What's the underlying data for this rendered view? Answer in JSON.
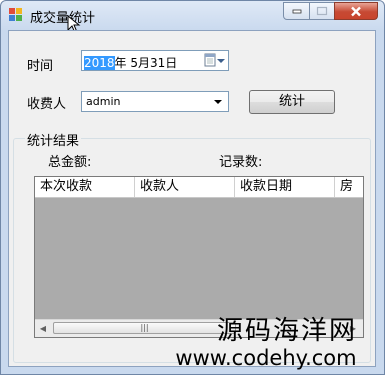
{
  "window": {
    "title": "成交量统计"
  },
  "filters": {
    "time_label": "时间",
    "date_selected": "2018",
    "date_rest": "年  5月31日",
    "payee_label": "收费人",
    "payee_value": "admin",
    "stats_button": "统计"
  },
  "results": {
    "group_title": "统计结果",
    "total_label": "总金额:",
    "count_label": "记录数:"
  },
  "grid": {
    "columns": [
      "本次收款",
      "收款人",
      "收款日期",
      "房"
    ],
    "rows": []
  },
  "watermark": {
    "line1": "源码海洋网",
    "line2": "www.codehy.com"
  },
  "colors": {
    "title_bar": "#c9d9ee",
    "close_button": "#c74a34",
    "selection": "#3399ff",
    "grid_empty": "#ababab"
  }
}
